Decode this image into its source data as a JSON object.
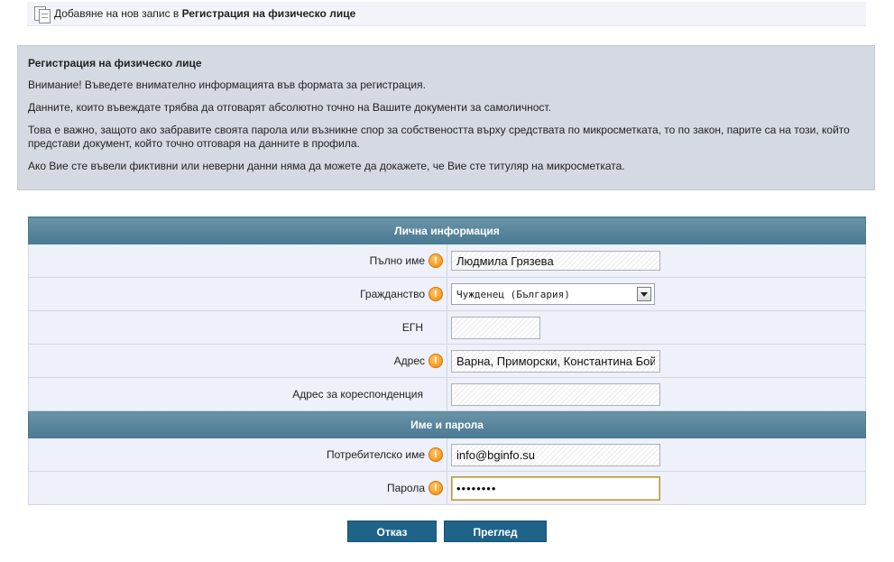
{
  "breadcrumb": {
    "prefix": "Добавяне на нов запис в",
    "target": "Регистрация на физическо лице"
  },
  "notice": {
    "title": "Регистрация на физическо лице",
    "paragraphs": [
      "Внимание! Въведете внимателно информацията във формата за регистрация.",
      "Данните, които въвеждате трябва да отговарят абсолютно точно на Вашите документи за самоличност.",
      "Това е важно, защото ако забравите своята парола или възникне спор за собствеността върху средствата по микросметката, то по закон, парите са на този, който представи документ, който точно отговаря на данните в профила.",
      "Ако Вие сте въвели фиктивни или неверни данни няма да можете да докажете, че Вие сте титуляр на микросметката."
    ]
  },
  "personal": {
    "header": "Лична информация",
    "full_name": {
      "label": "Пълно име",
      "value": "Людмила Грязева"
    },
    "citizenship": {
      "label": "Гражданство",
      "value": "Чужденец (България)"
    },
    "egn": {
      "label": "ЕГН",
      "value": ""
    },
    "address": {
      "label": "Адрес",
      "value": "Варна, Приморски, Константина Бой"
    },
    "corr_address": {
      "label": "Адрес за кореспонденция",
      "value": ""
    }
  },
  "credentials": {
    "header": "Име и парола",
    "username": {
      "label": "Потребителско име",
      "value": "info@bginfo.su"
    },
    "password": {
      "label": "Парола",
      "value": "••••••••"
    }
  },
  "buttons": {
    "cancel": "Отказ",
    "preview": "Преглед"
  },
  "icons": {
    "required": "exclamation-icon",
    "breadcrumb": "document-icon"
  },
  "colors": {
    "section_header": "#4a7a93",
    "button": "#1f6488",
    "required": "#f08a00",
    "notice_bg": "#d5d9e2"
  }
}
